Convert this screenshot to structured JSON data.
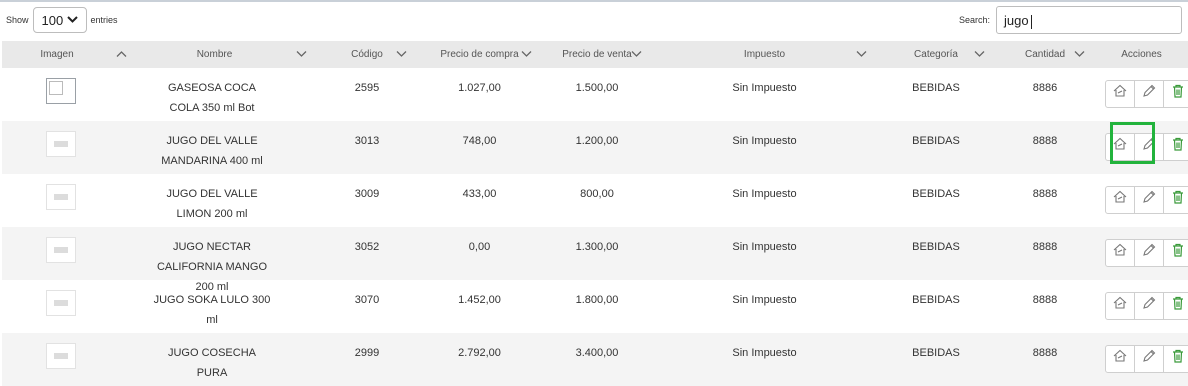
{
  "controls": {
    "show_label": "Show",
    "entries_value": "100",
    "entries_label": "entries",
    "search_label": "Search:",
    "search_value": "jugo"
  },
  "columns": [
    "Imagen",
    "Nombre",
    "Código",
    "Precio de compra",
    "Precio de venta",
    "Impuesto",
    "Categoría",
    "Cantidad",
    "Acciones"
  ],
  "rows": [
    {
      "nombre": "GASEOSA COCA COLA 350 ml Bot",
      "codigo": "2595",
      "compra": "1.027,00",
      "venta": "1.500,00",
      "impuesto": "Sin Impuesto",
      "categoria": "BEBIDAS",
      "cantidad": "8886"
    },
    {
      "nombre": "JUGO DEL VALLE MANDARINA 400 ml",
      "codigo": "3013",
      "compra": "748,00",
      "venta": "1.200,00",
      "impuesto": "Sin Impuesto",
      "categoria": "BEBIDAS",
      "cantidad": "8888"
    },
    {
      "nombre": "JUGO DEL VALLE LIMON 200 ml",
      "codigo": "3009",
      "compra": "433,00",
      "venta": "800,00",
      "impuesto": "Sin Impuesto",
      "categoria": "BEBIDAS",
      "cantidad": "8888"
    },
    {
      "nombre": "JUGO NECTAR CALIFORNIA MANGO 200 ml",
      "codigo": "3052",
      "compra": "0,00",
      "venta": "1.300,00",
      "impuesto": "Sin Impuesto",
      "categoria": "BEBIDAS",
      "cantidad": "8888"
    },
    {
      "nombre": "JUGO SOKA LULO 300 ml",
      "codigo": "3070",
      "compra": "1.452,00",
      "venta": "1.800,00",
      "impuesto": "Sin Impuesto",
      "categoria": "BEBIDAS",
      "cantidad": "8888"
    },
    {
      "nombre": "JUGO COSECHA PURA",
      "codigo": "2999",
      "compra": "2.792,00",
      "venta": "3.400,00",
      "impuesto": "Sin Impuesto",
      "categoria": "BEBIDAS",
      "cantidad": "8888"
    }
  ],
  "colors": {
    "accent_green": "#22b33c",
    "delete_green": "#3a9a3a"
  },
  "icons": {
    "send": "send-icon",
    "edit": "pencil-icon",
    "delete": "trash-icon"
  }
}
